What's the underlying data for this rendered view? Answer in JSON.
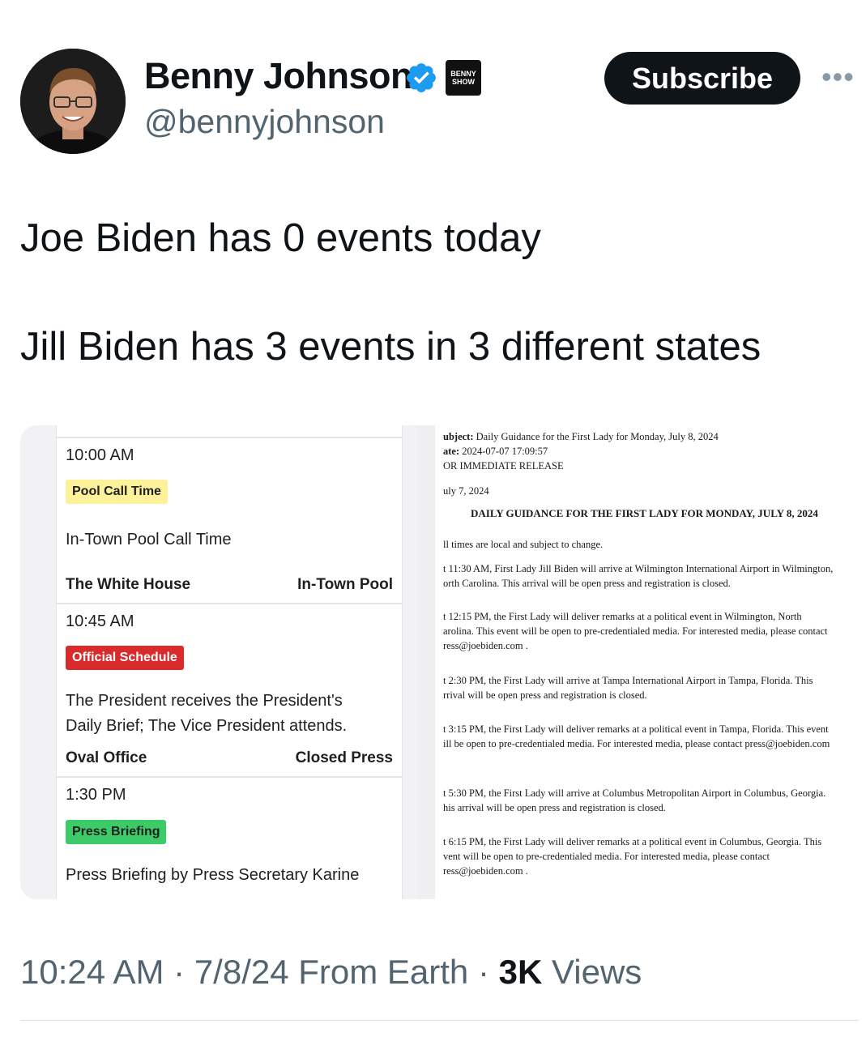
{
  "author": {
    "name": "Benny Johnson",
    "handle": "@bennyjohnson",
    "badge_text": [
      "BENNY",
      "SHOW"
    ],
    "verified_icon": "verified-badge-icon",
    "subscribe_label": "Subscribe",
    "more_label": "•••"
  },
  "tweet": {
    "line1": "Joe Biden has 0 events today",
    "line2": "Jill Biden has 3 events in 3 different states"
  },
  "left_schedule": {
    "events": [
      {
        "time": "10:00 AM",
        "tag": "Pool Call Time",
        "tag_color": "#fdf19a",
        "description": [
          "In-Town Pool Call Time"
        ],
        "location": "The White House",
        "access": "In-Town Pool"
      },
      {
        "time": "10:45 AM",
        "tag": "Official Schedule",
        "tag_color": "#d92b2b",
        "description": [
          "The President receives the President's",
          "Daily Brief; The Vice President attends."
        ],
        "location": "Oval Office",
        "access": "Closed Press"
      },
      {
        "time": "1:30 PM",
        "tag": "Press Briefing",
        "tag_color": "#3dcb6a",
        "description": [
          "Press Briefing by Press Secretary Karine"
        ],
        "location": "",
        "access": ""
      }
    ]
  },
  "right_doc": {
    "subject_label": "ubject:",
    "subject": "Daily Guidance for the First Lady for Monday, July 8, 2024",
    "date_label": "ate:",
    "date": "2024-07-07 17:09:57",
    "release": "OR IMMEDIATE RELEASE",
    "dateline": "uly 7, 2024",
    "heading": "DAILY GUIDANCE FOR THE FIRST LADY FOR MONDAY, JULY 8, 2024",
    "note": "ll times are local and subject to change.",
    "items": [
      [
        "t 11:30 AM, First Lady Jill Biden will arrive at Wilmington International Airport in Wilmington,",
        "orth Carolina. This arrival will be open press and registration is closed."
      ],
      [
        "t 12:15 PM, the First Lady will deliver remarks at a political event in Wilmington, North",
        "arolina. This event will be open to pre-credentialed media. For interested media, please contact",
        "ress@joebiden.com ."
      ],
      [
        "t 2:30 PM, the First Lady will arrive at Tampa International Airport in Tampa, Florida. This",
        "rrival will be open press and registration is closed."
      ],
      [
        "t 3:15 PM, the First Lady will deliver remarks at a political event in Tampa, Florida. This event",
        "ill be open to pre-credentialed media. For interested media, please contact press@joebiden.com"
      ],
      [
        "t 5:30 PM, the First Lady will arrive at Columbus Metropolitan Airport in Columbus, Georgia.",
        "his arrival will be open press and registration is closed."
      ],
      [
        "t 6:15 PM, the First Lady will deliver remarks at a political event in Columbus, Georgia. This",
        "vent will be open to pre-credentialed media. For interested media, please contact",
        "ress@joebiden.com ."
      ]
    ]
  },
  "footer": {
    "time": "10:24 AM",
    "sep1": "·",
    "date": "7/8/24 From Earth",
    "sep2": "·",
    "views_count": "3K",
    "views_label": "Views"
  }
}
